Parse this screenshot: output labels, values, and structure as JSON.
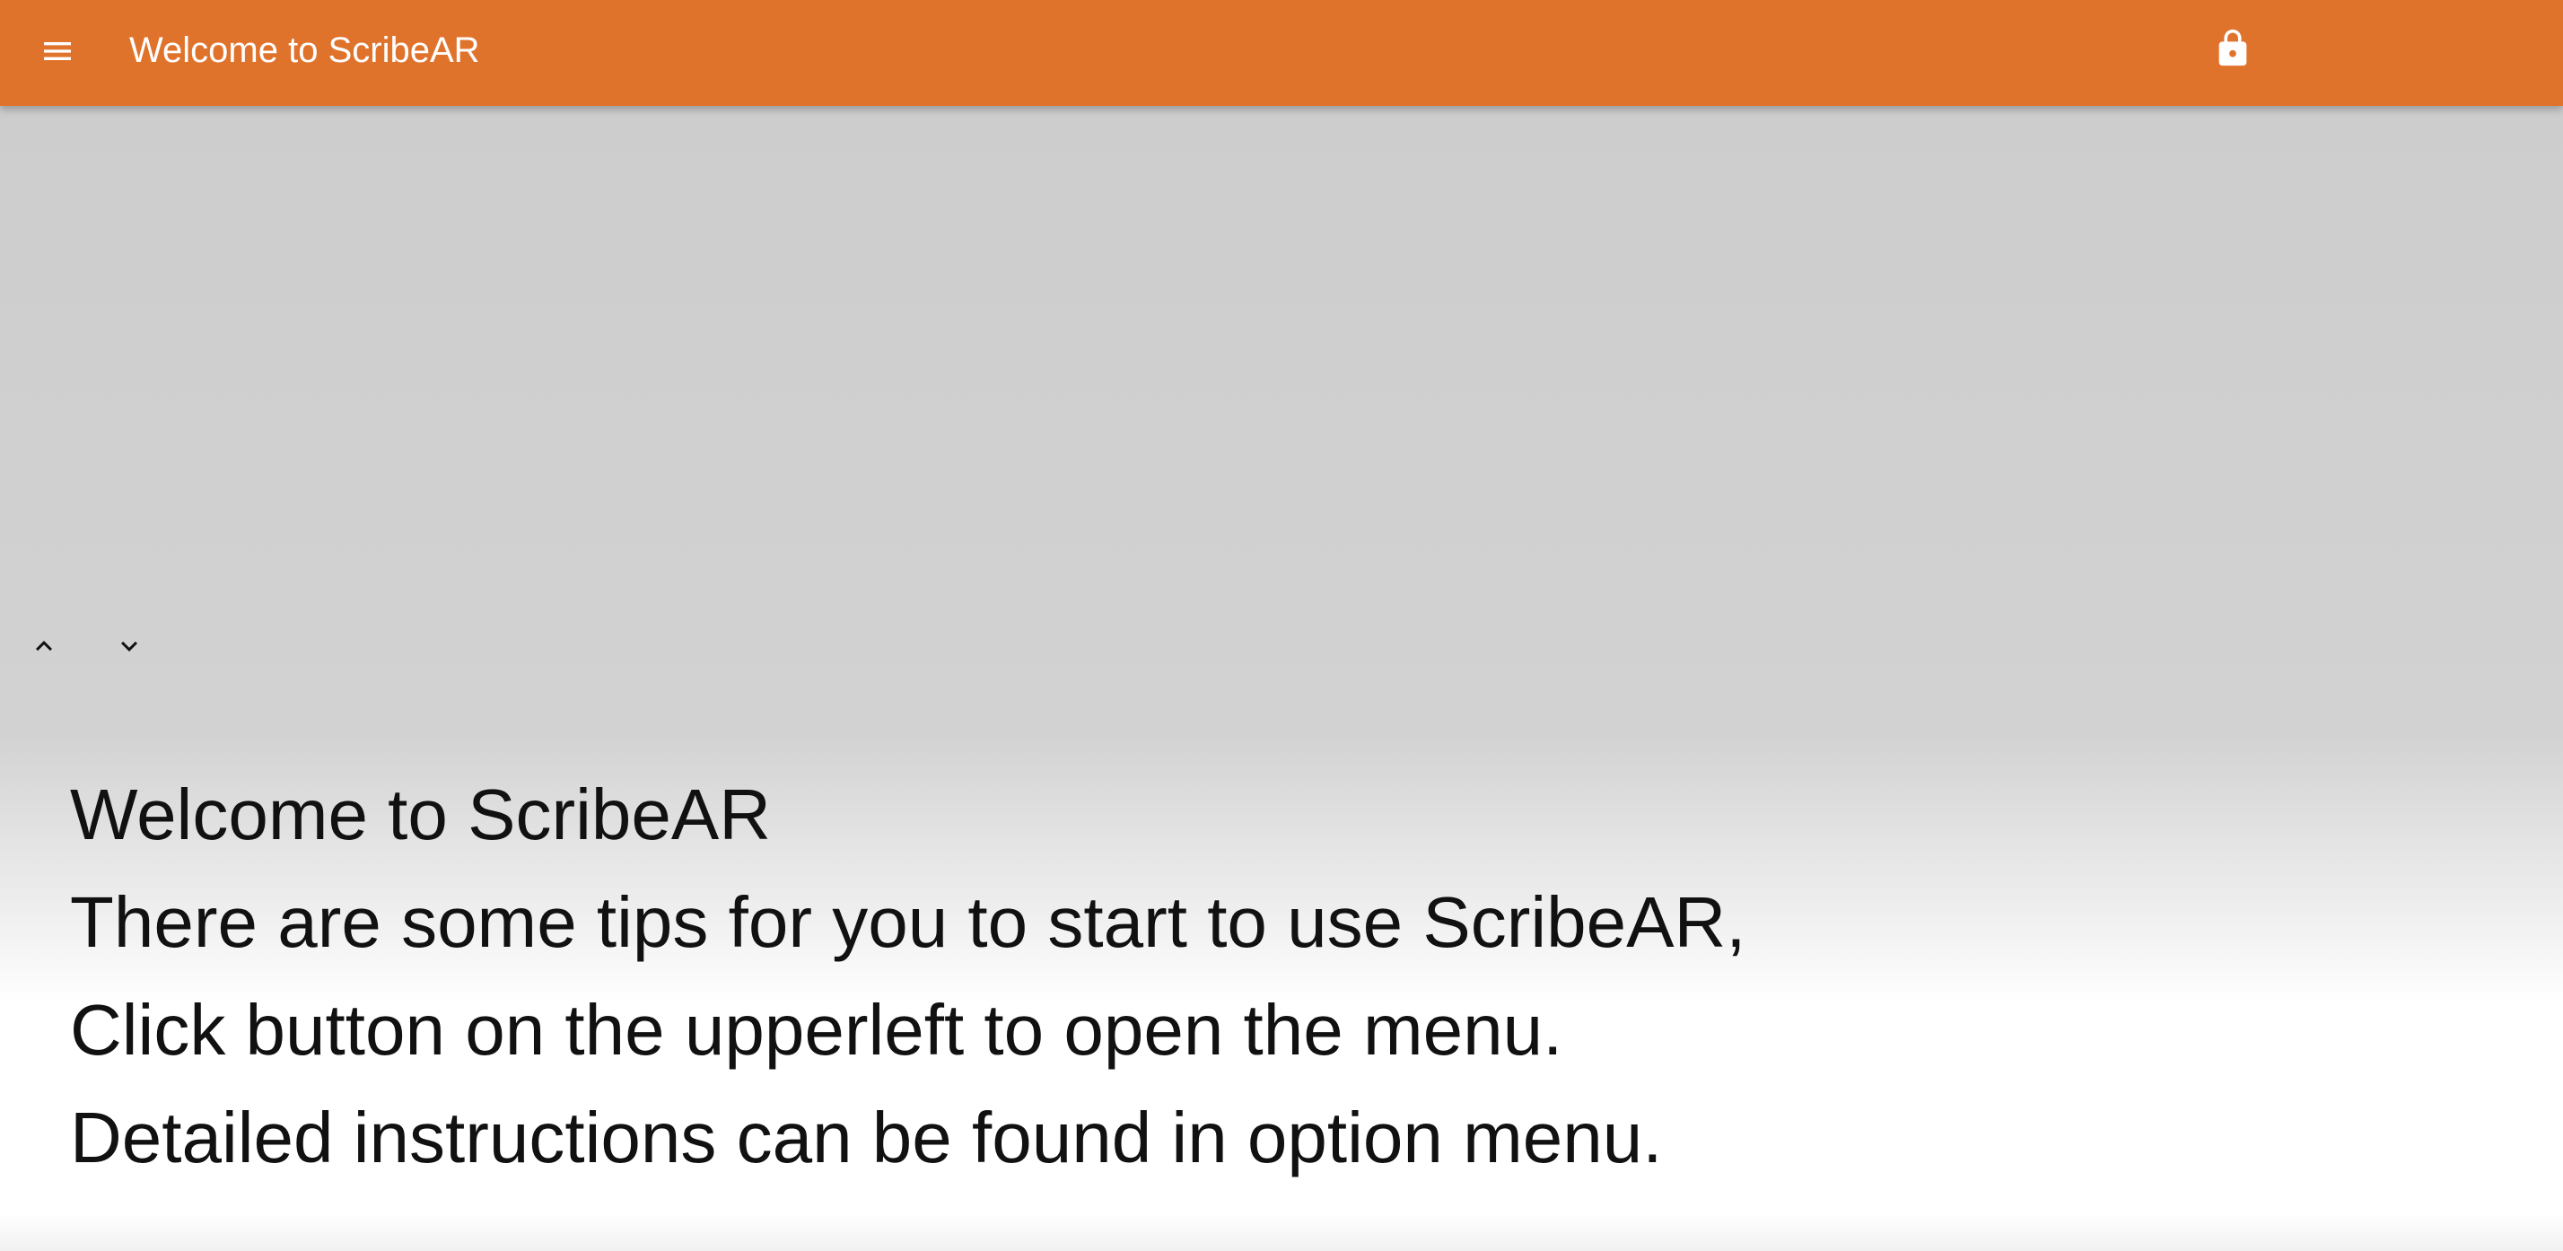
{
  "appbar": {
    "title": "Welcome to ScribeAR",
    "menu_icon": "hamburger-menu-icon",
    "lock_icon": "lock-icon",
    "color": "#e0732c"
  },
  "controls": {
    "scroll_up_icon": "chevron-up-icon",
    "scroll_down_icon": "chevron-down-icon"
  },
  "caption": {
    "lines": [
      "Welcome to ScribeAR",
      "There are some tips for you to start to use ScribeAR,",
      "Click button on the upperleft to open the menu.",
      "Detailed instructions can be found in option menu."
    ]
  }
}
